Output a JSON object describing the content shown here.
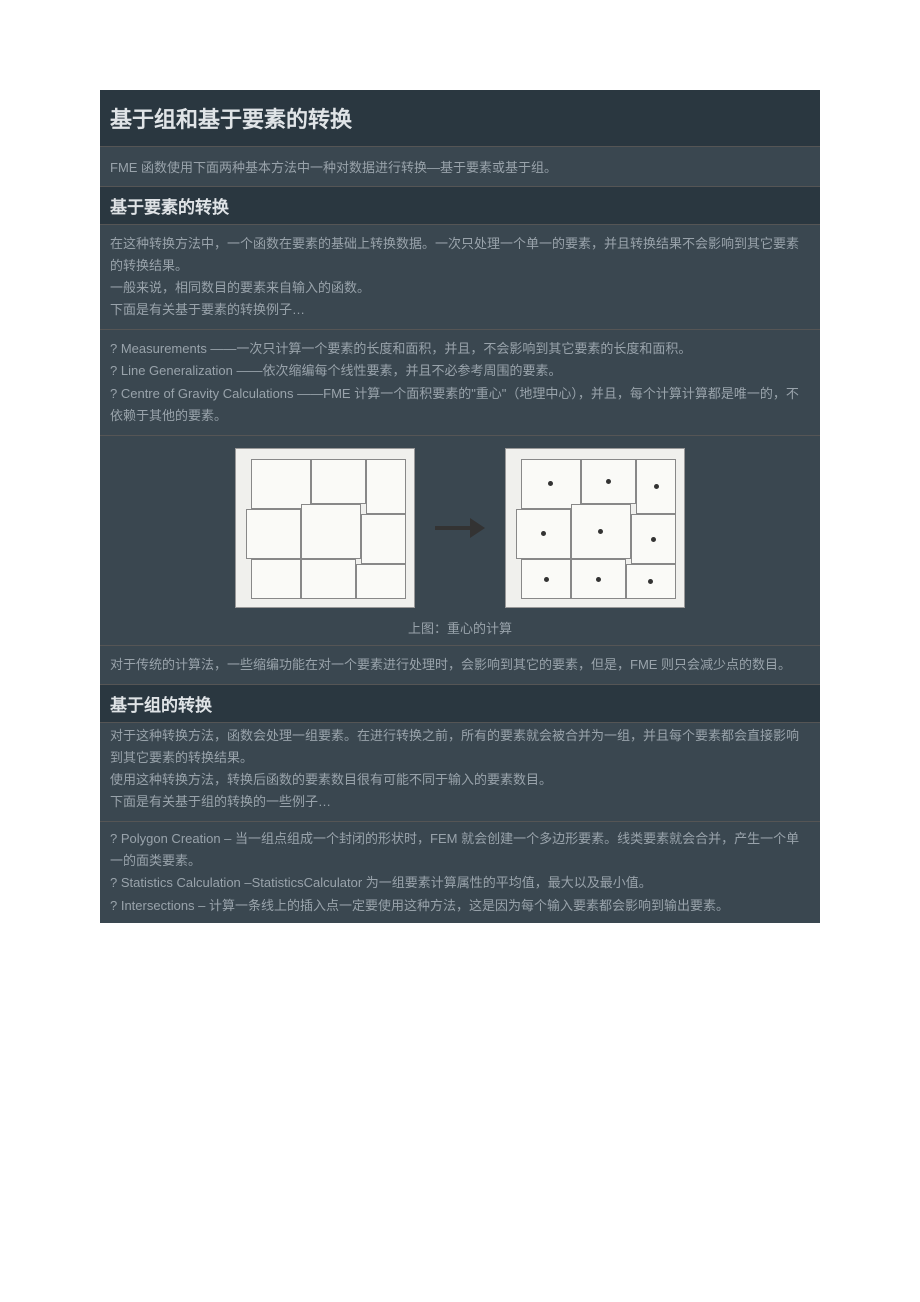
{
  "main_title": "基于组和基于要素的转换",
  "intro": "FME 函数使用下面两种基本方法中一种对数据进行转换—基于要素或基于组。",
  "section1": {
    "title": "基于要素的转换",
    "para1_line1": "在这种转换方法中，一个函数在要素的基础上转换数据。一次只处理一个单一的要素，并且转换结果不会影响到其它要素的转换结果。",
    "para1_line2": "一般来说，相同数目的要素来自输入的函数。",
    "para1_line3": "下面是有关基于要素的转换例子…",
    "bullet1": "? Measurements ——一次只计算一个要素的长度和面积，并且，不会影响到其它要素的长度和面积。",
    "bullet2": "? Line Generalization ——依次缩编每个线性要素，并且不必参考周围的要素。",
    "bullet3": "? Centre of Gravity Calculations ——FME 计算一个面积要素的\"重心\"（地理中心），并且，每个计算计算都是唯一的，不依赖于其他的要素。",
    "caption": "上图：重心的计算",
    "para2": "对于传统的计算法，一些缩编功能在对一个要素进行处理时，会影响到其它的要素，但是，FME 则只会减少点的数目。"
  },
  "section2": {
    "title": "基于组的转换",
    "para1_line1": "对于这种转换方法，函数会处理一组要素。在进行转换之前，所有的要素就会被合并为一组，并且每个要素都会直接影响到其它要素的转换结果。",
    "para1_line2": "使用这种转换方法，转换后函数的要素数目很有可能不同于输入的要素数目。",
    "para1_line3": "下面是有关基于组的转换的一些例子…",
    "bullet1": "? Polygon Creation –  当一组点组成一个封闭的形状时，FEM 就会创建一个多边形要素。线类要素就会合并，产生一个单一的面类要素。",
    "bullet2": "? Statistics Calculation –StatisticsCalculator 为一组要素计算属性的平均值，最大以及最小值。",
    "bullet3": "? Intersections –  计算一条线上的插入点一定要使用这种方法，这是因为每个输入要素都会影响到输出要素。"
  }
}
